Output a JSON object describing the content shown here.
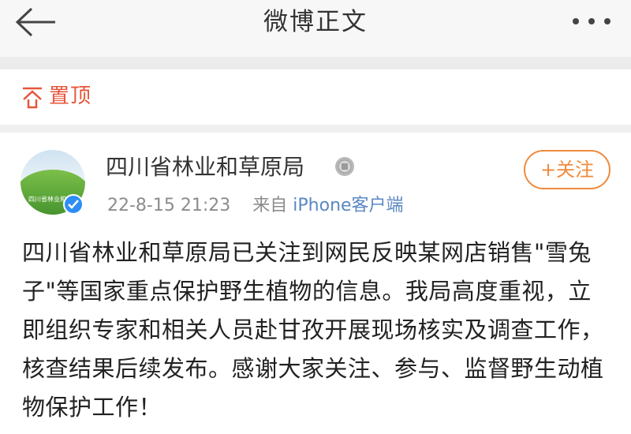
{
  "nav": {
    "title": "微博正文",
    "back_icon": "arrow-left-icon",
    "more_icon": "more-dots-icon"
  },
  "pin": {
    "icon": "pin-top-icon",
    "label": "置顶",
    "color": "#e8553a"
  },
  "post": {
    "author": "四川省林业和草原局",
    "badge_icon": "medal-icon",
    "verified_icon": "verified-badge-icon",
    "timestamp": "22-8-15 21:23",
    "source_prefix": "来自",
    "source": "iPhone客户端",
    "follow_label": "+关注",
    "body": "四川省林业和草原局已关注到网民反映某网店销售\"雪兔子\"等国家重点保护野生植物的信息。我局高度重视，立即组织专家和相关人员赴甘孜开展现场核实及调查工作，核查结果后续发布。感谢大家关注、参与、监督野生动植物保护工作！",
    "avatar_text": "四川省林业和"
  },
  "colors": {
    "accent": "#f08a3c",
    "link": "#5a87c2",
    "verified": "#2e8ef5"
  }
}
